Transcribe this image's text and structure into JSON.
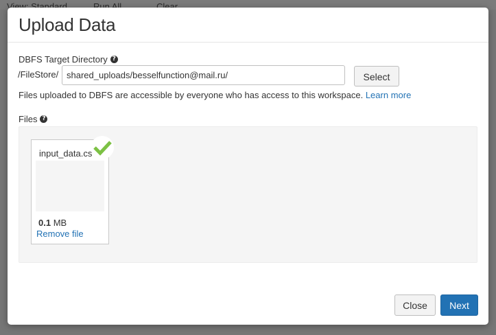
{
  "background_toolbar": {
    "item1": "View: Standard",
    "item2": "Run All",
    "item3": "Clear"
  },
  "modal": {
    "title": "Upload Data",
    "target_label": "DBFS Target Directory",
    "path_prefix": "/FileStore/",
    "path_value": "shared_uploads/besselfunction@mail.ru/",
    "select_label": "Select",
    "info_text": "Files uploaded to DBFS are accessible by everyone who has access to this workspace.",
    "learn_more": "Learn more",
    "files_label": "Files",
    "file": {
      "name": "input_data.csv",
      "size_value": "0.1",
      "size_unit": "MB",
      "remove_label": "Remove file",
      "status_icon": "check-icon"
    },
    "close_label": "Close",
    "next_label": "Next"
  },
  "colors": {
    "accent": "#2272b4",
    "success": "#7cc144",
    "backdrop": "#767676"
  }
}
